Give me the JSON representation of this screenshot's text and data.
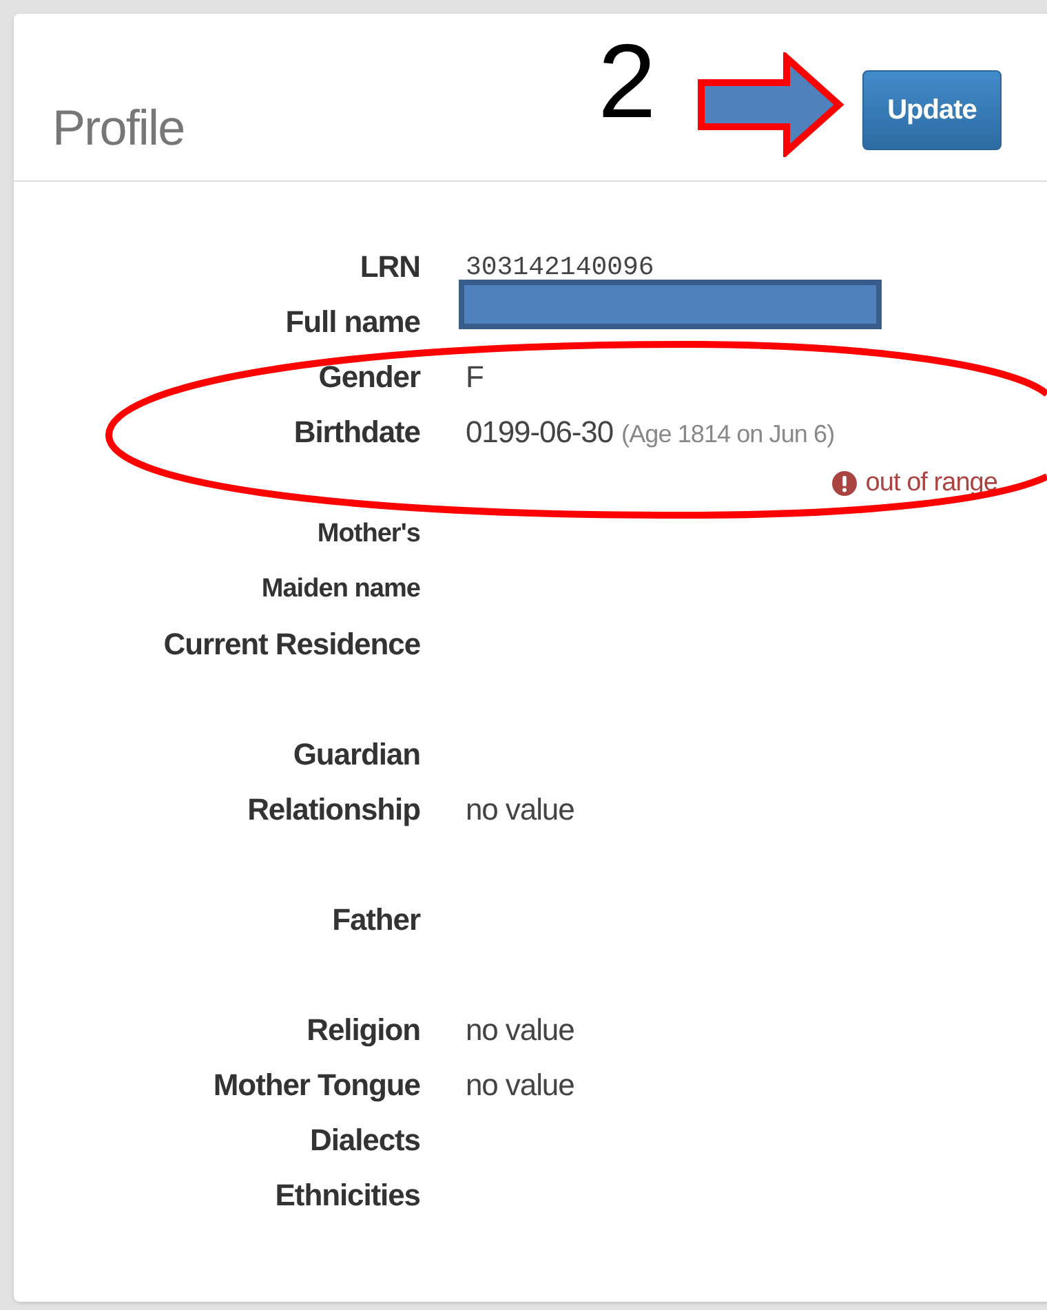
{
  "panel": {
    "title": "Profile",
    "update_button": "Update"
  },
  "annotation": {
    "step_number": "2"
  },
  "sections": [
    [
      {
        "label": "LRN",
        "value": "303142140096",
        "kind": "code"
      },
      {
        "label": "Full name",
        "kind": "redacted"
      },
      {
        "label": "Gender",
        "value": "F",
        "kind": "text"
      },
      {
        "label": "Birthdate",
        "value": "0199-06-30",
        "note": "(Age 1814 on Jun 6)",
        "error": "out of range",
        "kind": "text"
      },
      {
        "label": "Mother's",
        "label_line2": "Maiden name",
        "kind": "text"
      },
      {
        "label": "Current Residence",
        "kind": "text"
      }
    ],
    [
      {
        "label": "Guardian",
        "kind": "text"
      },
      {
        "label": "Relationship",
        "value": "no value",
        "kind": "text"
      }
    ],
    [
      {
        "label": "Father",
        "kind": "text"
      }
    ],
    [
      {
        "label": "Religion",
        "value": "no value",
        "kind": "text"
      },
      {
        "label": "Mother Tongue",
        "value": "no value",
        "kind": "text"
      },
      {
        "label": "Dialects",
        "kind": "text"
      },
      {
        "label": "Ethnicities",
        "kind": "text"
      }
    ]
  ]
}
